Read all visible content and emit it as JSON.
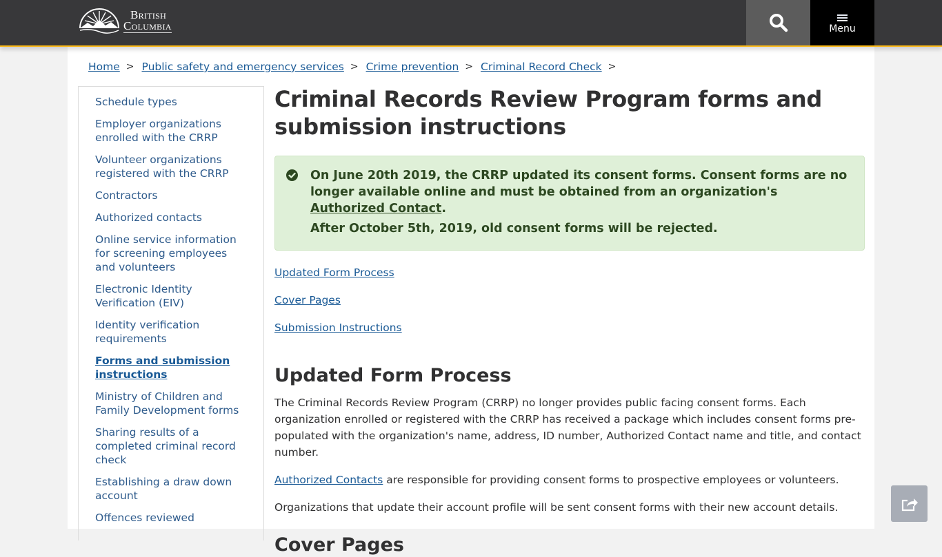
{
  "header": {
    "logo_line1": "British",
    "logo_line2": "Columbia",
    "search_icon": "search-icon",
    "menu_icon": "hamburger-icon",
    "menu_label": "Menu",
    "accent_color": "#fcba19"
  },
  "breadcrumb": [
    {
      "label": "Home"
    },
    {
      "label": "Public safety and emergency services"
    },
    {
      "label": "Crime prevention"
    },
    {
      "label": "Criminal Record Check"
    }
  ],
  "breadcrumb_separator": ">",
  "sidenav": {
    "items": [
      {
        "label": "Schedule types"
      },
      {
        "label": "Employer organizations enrolled with the CRRP"
      },
      {
        "label": "Volunteer organizations registered with the CRRP"
      },
      {
        "label": "Contractors"
      },
      {
        "label": "Authorized contacts"
      },
      {
        "label": "Online service information for screening employees and volunteers"
      },
      {
        "label": "Electronic Identity Verification (EIV)"
      },
      {
        "label": "Identity verification requirements"
      },
      {
        "label": "Forms and submission instructions",
        "active": true
      },
      {
        "label": "Ministry of Children and Family Development forms"
      },
      {
        "label": "Sharing results of a completed criminal record check"
      },
      {
        "label": "Establishing a draw down account"
      },
      {
        "label": "Offences reviewed"
      }
    ]
  },
  "main": {
    "title": "Criminal Records Review Program forms and submission instructions",
    "alert": {
      "icon": "check-circle-icon",
      "line1_before": "On June 20th 2019, the CRRP updated its consent forms. Consent forms are no longer available online and must be obtained from an organization's ",
      "line1_link": "Authorized Contact",
      "line1_after": ".",
      "line2": "After October 5th, 2019, old consent forms will be rejected.",
      "bg_color": "#dff0d8",
      "text_color": "#2d4821"
    },
    "jump_links": [
      {
        "label": "Updated Form Process"
      },
      {
        "label": "Cover Pages"
      },
      {
        "label": "Submission Instructions "
      }
    ],
    "section1": {
      "heading": "Updated Form Process",
      "para1": "The Criminal Records Review Program (CRRP) no longer provides public facing consent forms. Each organization enrolled or registered with the CRRP has received a package which includes consent forms pre-populated with the organization's name, address, ID number, Authorized Contact name and title, and contact number.",
      "para2_link": "Authorized Contacts",
      "para2_rest": " are responsible for providing consent forms to prospective employees or volunteers.",
      "para3": "Organizations that update their account profile will be sent consent forms with their new account details."
    },
    "section2": {
      "heading": "Cover Pages"
    }
  },
  "share": {
    "icon": "share-icon"
  }
}
